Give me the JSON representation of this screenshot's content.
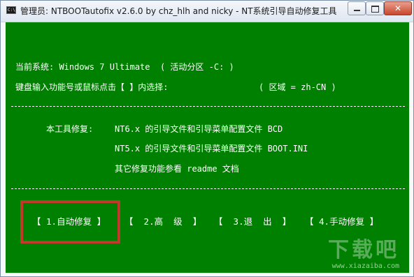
{
  "window": {
    "title": "管理员:  NTBOOTautofix v2.6.0 by chz_hlh and nicky - NT系统引导自动修复工具",
    "icon_label": "C:\\",
    "controls": {
      "minimize_icon": "minimize-icon",
      "maximize_icon": "maximize-icon",
      "close_label": "✕"
    }
  },
  "console": {
    "background": "#008000",
    "foreground": "#ffffff",
    "lines": {
      "current_system": "当前系统: Windows 7 Ultimate  ( 活动分区 -C: )",
      "prompt": "键盘输入功能号或鼠标点击【 】内选择:",
      "locale": "( 区域 = zh-CN )",
      "tool_repair_label": "本工具修复:",
      "nt6": "NT6.x 的引导文件和引导菜单配置文件 BCD",
      "nt5": "NT5.x 的引导文件和引导菜单配置文件 BOOT.INI",
      "readme": "其它修复功能参看 readme 文档"
    },
    "menu": [
      {
        "label": "【 1.自动修复 】"
      },
      {
        "label": "【  2.高  级  】"
      },
      {
        "label": "【  3.退  出  】"
      },
      {
        "label": "【 4.手动修复 】"
      }
    ],
    "highlight_color": "#c0392b"
  },
  "watermark": {
    "logo": "下载吧",
    "url": "www.xiazaiba.com"
  }
}
